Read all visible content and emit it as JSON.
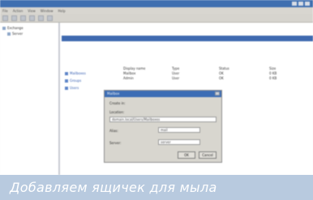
{
  "caption": "Добавляем ящичек для мыла",
  "window": {
    "menu": [
      "File",
      "Action",
      "View",
      "Window",
      "Help"
    ]
  },
  "tree": {
    "items": [
      {
        "label": "Exchange",
        "level": 0
      },
      {
        "label": "Server",
        "level": 1
      }
    ]
  },
  "left_links": [
    "Mailboxes",
    "Groups",
    "Users"
  ],
  "grid": {
    "rows": [
      [
        "Display name",
        "Type",
        "Status",
        "Size"
      ],
      [
        "Mailbox",
        "User",
        "OK",
        "0 KB"
      ],
      [
        "Admin",
        "User",
        "OK",
        "0 KB"
      ]
    ]
  },
  "dialog": {
    "title": "Mailbox",
    "label_top": "Create in:",
    "label_path": "Location:",
    "path_value": "domain.local/Users/Mailboxes",
    "label_alias": "Alias:",
    "alias_value": "mail",
    "label_server": "Server:",
    "server_value": "server",
    "ok_label": "OK",
    "cancel_label": "Cancel"
  }
}
